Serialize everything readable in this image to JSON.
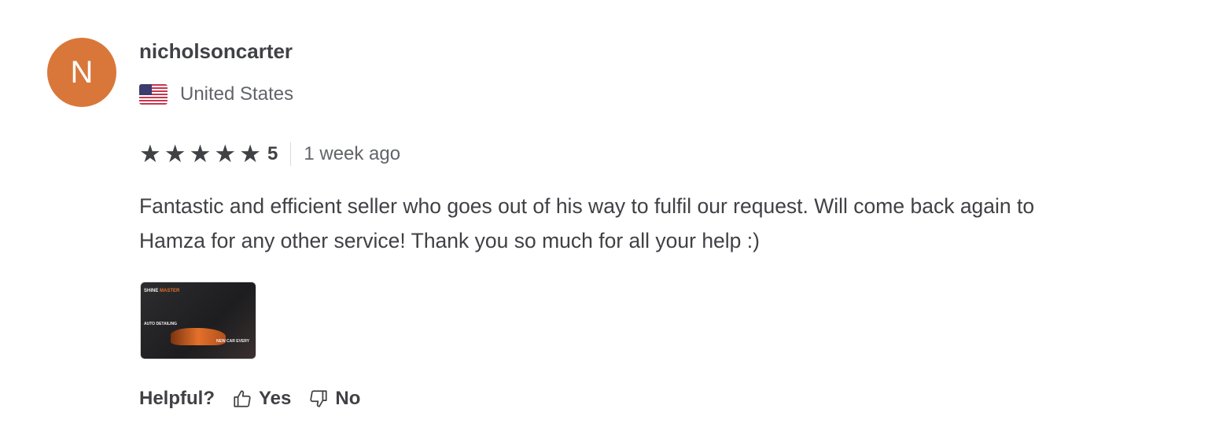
{
  "review": {
    "avatar_letter": "N",
    "avatar_color": "#d9773a",
    "username": "nicholsoncarter",
    "country": "United States",
    "flag_icon": "us-flag-icon",
    "rating": 5,
    "rating_label": "5",
    "time": "1 week ago",
    "text": "Fantastic and efficient seller who goes out of his way to fulfil our request. Will come back again to Hamza for any other service! Thank you so much for all your help :)",
    "attachment": {
      "title_white": "SHINE ",
      "title_orange": "MASTER",
      "subtitle": "AUTO DETAILING",
      "banner": "NEW CAR EVERY"
    }
  },
  "helpful": {
    "label": "Helpful?",
    "yes": "Yes",
    "no": "No"
  }
}
